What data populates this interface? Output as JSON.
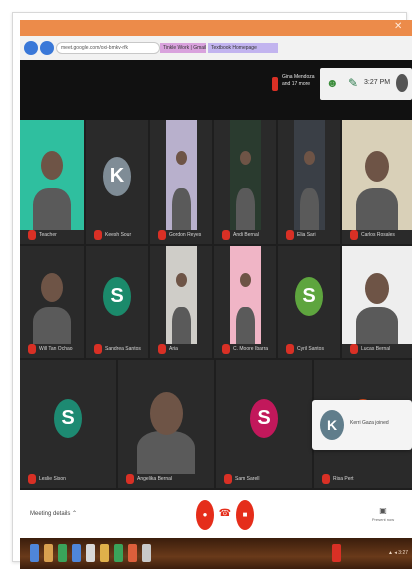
{
  "browser": {
    "url_text": "meet.google.com/oxi-bmkv-rfk",
    "bookmarks": [
      {
        "label": "Tinkle Work | Gmail"
      },
      {
        "label": "Textbook Homepage"
      }
    ],
    "close_glyph": "✕"
  },
  "meet_topbar": {
    "presenter_text": "Gina Mendoza and 17 more",
    "time": "3:27 PM",
    "people_icon": "people-icon",
    "chat_icon": "chat-icon"
  },
  "tiles": [
    {
      "type": "video",
      "name": "Teacher",
      "bg": "#2fbf9f"
    },
    {
      "type": "letter",
      "letter": "K",
      "name": "Keesh Sour",
      "color": "#7f8c96"
    },
    {
      "type": "video",
      "name": "Gordon Reyes",
      "bg": "#b8b0cc"
    },
    {
      "type": "video",
      "name": "Andi Bernal",
      "bg": "#2a3b2f"
    },
    {
      "type": "video",
      "name": "Elia Sari",
      "bg": "#3a3f46"
    },
    {
      "type": "video",
      "name": "Carlos Rosales",
      "bg": "#d9d0b8"
    },
    {
      "type": "video",
      "name": "Will Tan Ochao",
      "bg": "#2a2a2a"
    },
    {
      "type": "letter",
      "letter": "S",
      "name": "Sandrea Santos",
      "color": "#1b8a6b"
    },
    {
      "type": "video",
      "name": "Aria",
      "bg": "#cfcdc8"
    },
    {
      "type": "video",
      "name": "C. Moore Ibarra",
      "bg": "#f0b5c6"
    },
    {
      "type": "letter",
      "letter": "S",
      "name": "Cyril Santos",
      "color": "#5ea53e"
    },
    {
      "type": "video",
      "name": "Lucas Bernal",
      "bg": "#eeeeee"
    },
    {
      "type": "letter",
      "letter": "S",
      "name": "Leslie Sison",
      "color": "#1d8a72"
    },
    {
      "type": "video",
      "name": "Angelika Bernal",
      "bg": "#2a2a2a"
    },
    {
      "type": "letter",
      "letter": "S",
      "name": "Sam Sarell",
      "color": "#c2185b"
    },
    {
      "type": "letter",
      "letter": "",
      "name": "Risa Pert",
      "color": "#e8541f"
    }
  ],
  "popup": {
    "avatar_letter": "K",
    "text": "Kerri Gaza joined"
  },
  "controls": {
    "meeting_details": "Meeting details ⌃",
    "mic_icon": "mic-off-icon",
    "hangup_glyph": "☎",
    "cam_icon": "camera-off-icon",
    "present_icon_glyph": "▣",
    "present_label": "Present now"
  },
  "taskbar": {
    "tray_text": "▲ ◂ 3:27"
  },
  "colors": {
    "titlebar": "#ec8b4a",
    "red": "#e52d1a",
    "meet_dark": "#1e1e1e"
  }
}
